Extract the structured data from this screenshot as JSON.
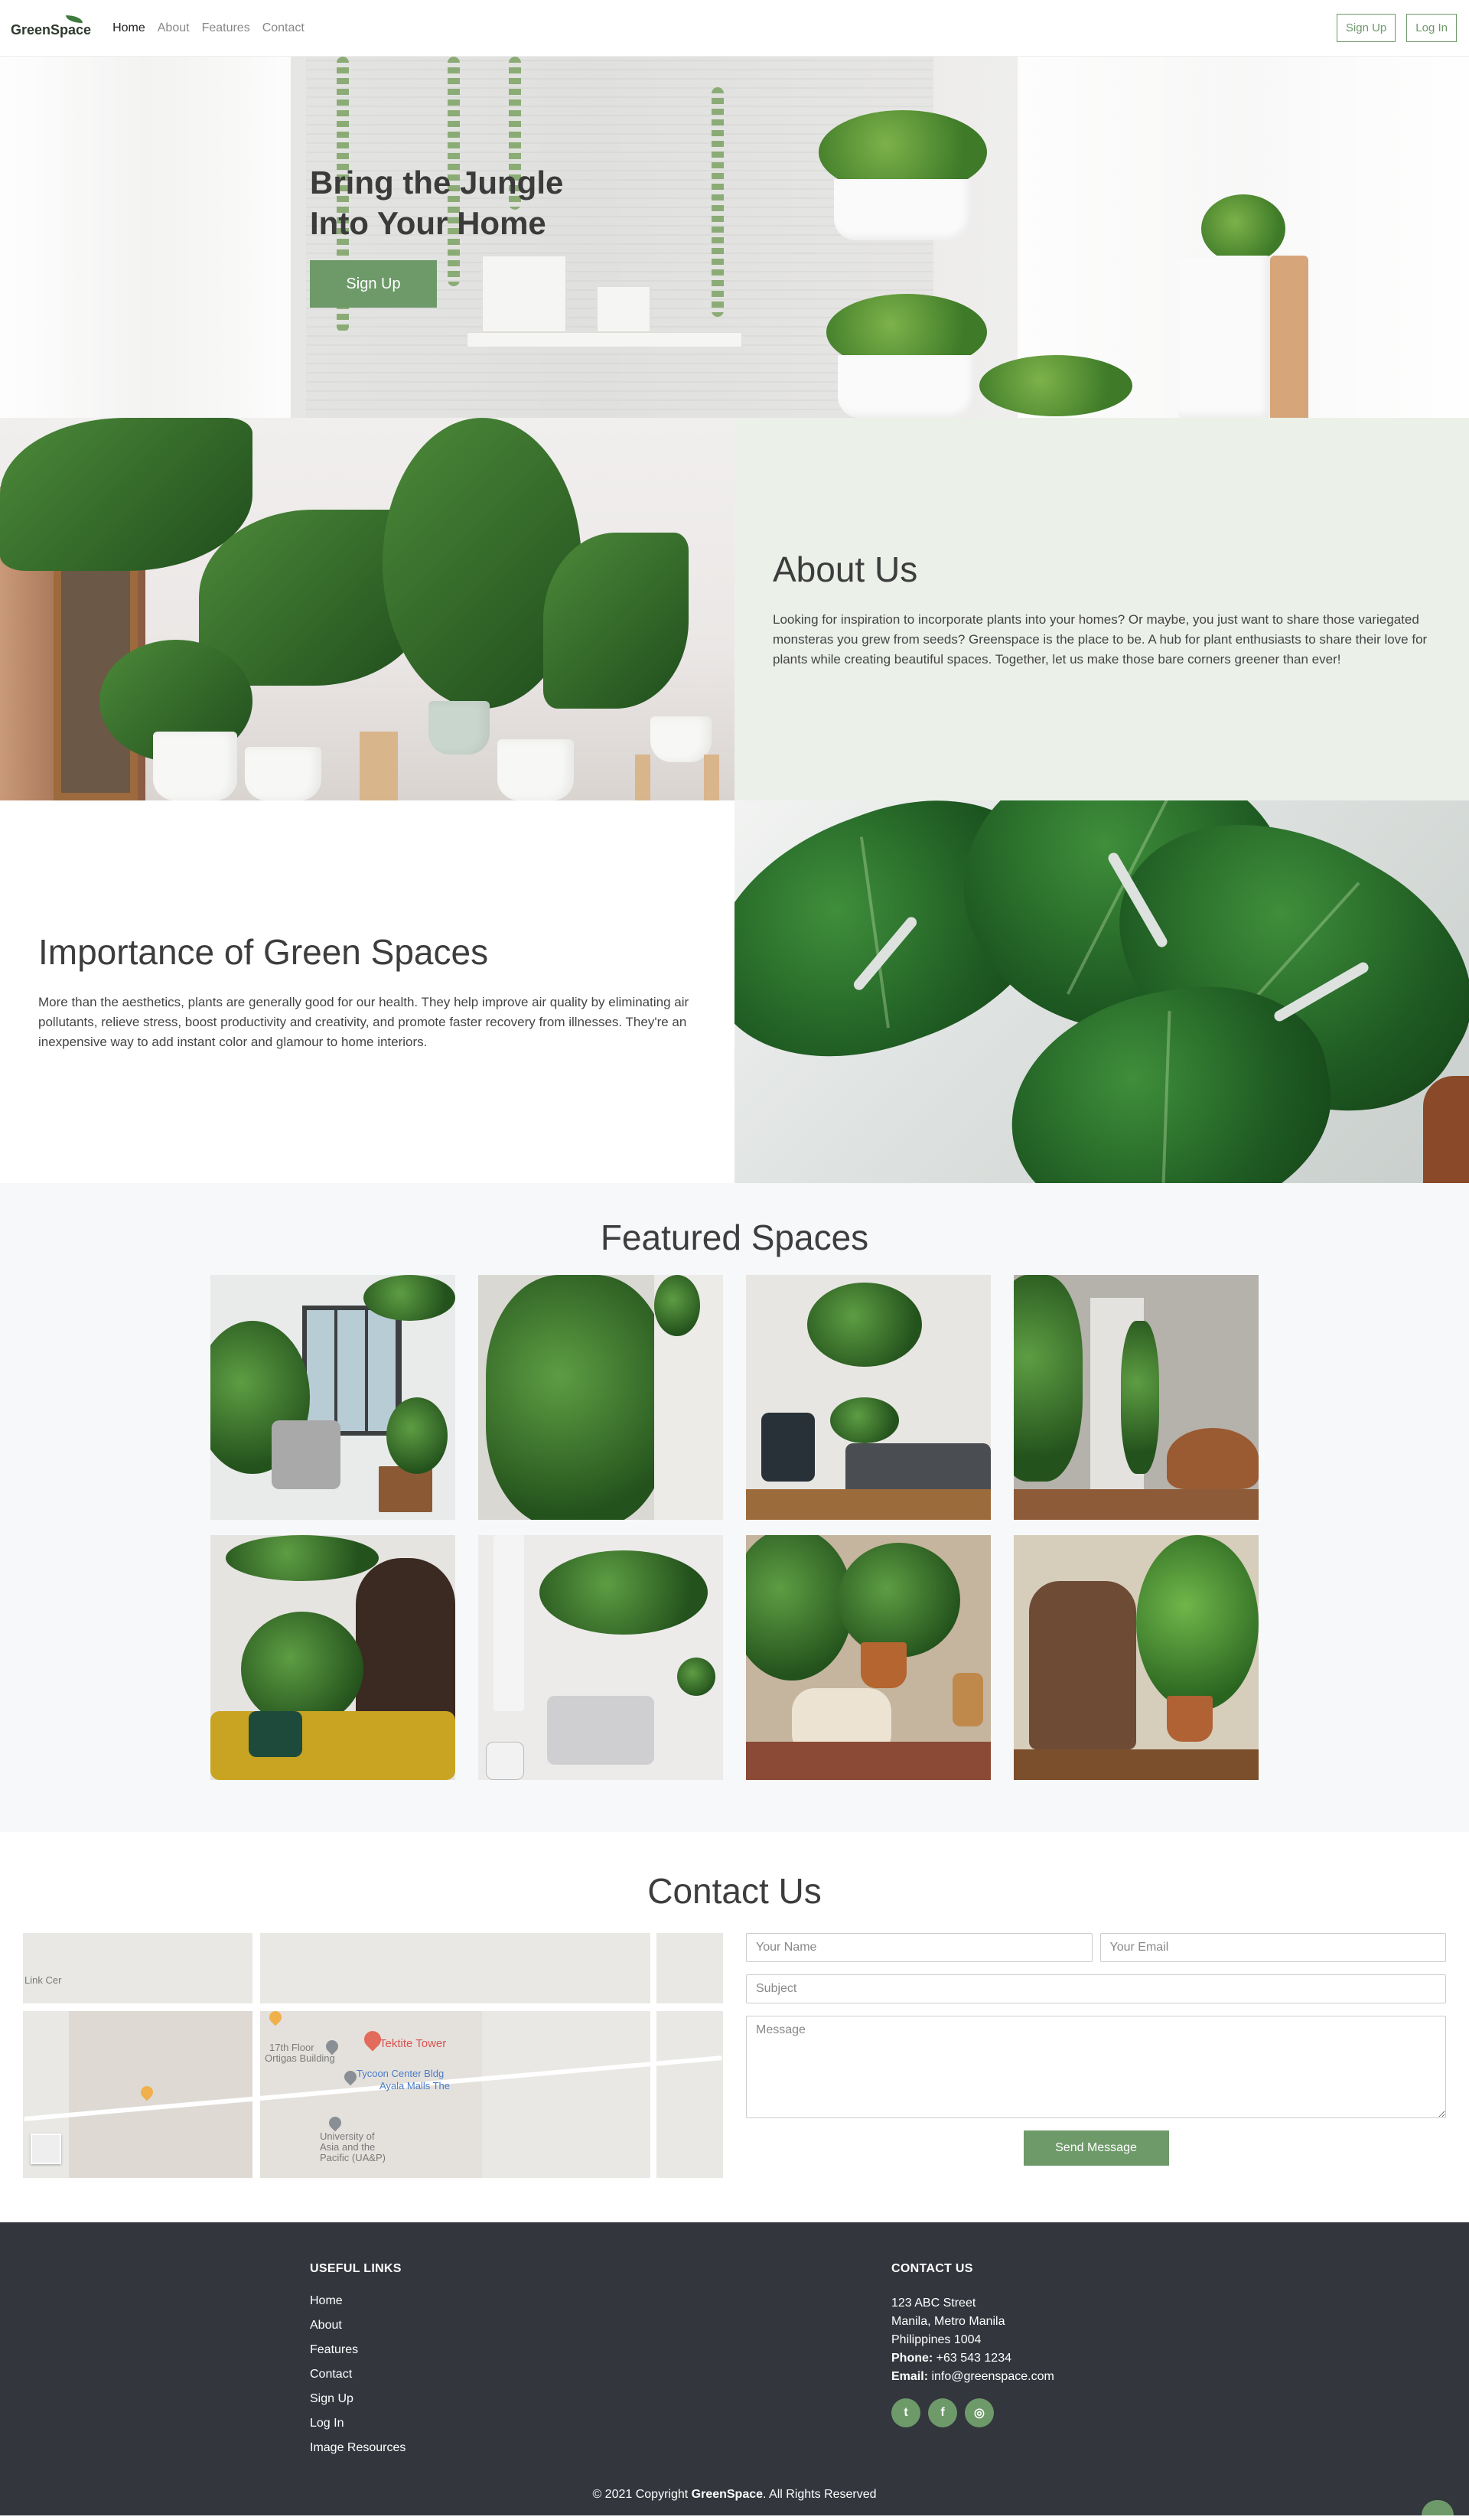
{
  "nav": {
    "logo": "GreenSpace",
    "links": [
      "Home",
      "About",
      "Features",
      "Contact"
    ],
    "signup": "Sign Up",
    "login": "Log In"
  },
  "hero": {
    "title": "Bring the Jungle\nInto Your Home",
    "button": "Sign Up"
  },
  "about": {
    "title": "About Us",
    "text": "Looking for inspiration to incorporate plants into your homes? Or maybe, you just want to share those variegated monsteras you grew from seeds? Greenspace is the place to be. A hub for plant enthusiasts to share their love for plants while creating beautiful spaces. Together, let us make those bare corners greener than ever!"
  },
  "importance": {
    "title": "Importance of Green Spaces",
    "text": "More than the aesthetics, plants are generally good for our health. They help improve air quality by eliminating air pollutants, relieve stress, boost productivity and creativity, and promote faster recovery from illnesses. They're an inexpensive way to add instant color and glamour to home interiors."
  },
  "featured": {
    "title": "Featured Spaces"
  },
  "contact": {
    "title": "Contact Us",
    "map_labels": {
      "place": "Tektite Tower",
      "floor": "17th Floor",
      "building": "Ortigas Building",
      "tycoon": "Tycoon Center Bldg",
      "ayala": "Ayala Malls The",
      "university": "University of",
      "university2": "Asia and the",
      "university3": "Pacific (UA&P)",
      "link": "Link Cer"
    },
    "name_placeholder": "Your Name",
    "email_placeholder": "Your Email",
    "subject_placeholder": "Subject",
    "message_placeholder": "Message",
    "send": "Send Message"
  },
  "footer": {
    "links_title": "USEFUL LINKS",
    "links": [
      "Home",
      "About",
      "Features",
      "Contact",
      "Sign Up",
      "Log In",
      "Image Resources"
    ],
    "contact_title": "CONTACT US",
    "address1": "123 ABC Street",
    "address2": "Manila, Metro Manila",
    "address3": "Philippines 1004",
    "phone_label": "Phone:",
    "phone": "+63 543 1234",
    "email_label": "Email:",
    "email": "info@greenspace.com",
    "socials": [
      {
        "name": "twitter-icon",
        "glyph": "t"
      },
      {
        "name": "facebook-icon",
        "glyph": "f"
      },
      {
        "name": "instagram-icon",
        "glyph": "◎"
      }
    ],
    "copyright_prefix": "© 2021 Copyright",
    "copyright_brand": "GreenSpace",
    "copyright_suffix": ". All Rights Reserved"
  },
  "colors": {
    "accent": "#6e9a6a",
    "about_bg": "#ebf0e9",
    "footer_bg": "#33363d"
  }
}
